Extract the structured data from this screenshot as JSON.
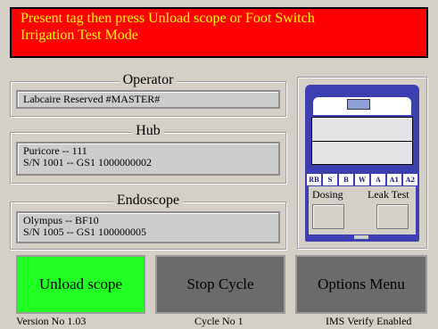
{
  "banner": {
    "line1": "Present tag then press Unload scope or Foot Switch",
    "line2": "Irrigation Test Mode"
  },
  "operator": {
    "title": "Operator",
    "value": "Labcaire Reserved #MASTER#"
  },
  "hub": {
    "title": "Hub",
    "line1": "Puricore -- 111",
    "line2": "S/N 1001 -- GS1 1000000002"
  },
  "endoscope": {
    "title": "Endoscope",
    "line1": "Olympus -- BF10",
    "line2": "S/N 1005 -- GS1 100000005"
  },
  "machine": {
    "buttons": [
      "RB",
      "S",
      "B",
      "W",
      "A",
      "A1",
      "A2"
    ],
    "dosing_label": "Dosing",
    "leak_label": "Leak Test"
  },
  "actions": {
    "unload": "Unload scope",
    "stop": "Stop Cycle",
    "options": "Options Menu"
  },
  "status": {
    "version": "Version No 1.03",
    "cycle": "Cycle No 1",
    "ims": "IMS Verify Enabled"
  },
  "colors": {
    "banner_bg": "#ff0000",
    "banner_text": "#ffff00",
    "unload_bg": "#22ff22",
    "disabled_bg": "#6b6b6b",
    "machine_blue": "#3d3fb0"
  }
}
